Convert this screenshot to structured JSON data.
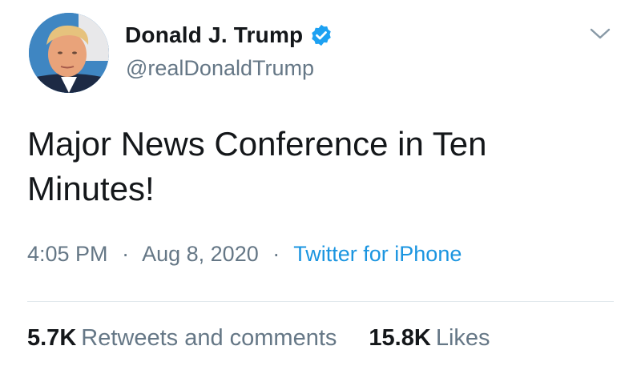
{
  "user": {
    "display_name": "Donald J. Trump",
    "handle": "@realDonaldTrump",
    "verified": true
  },
  "tweet": {
    "text": "Major News Conference in Ten Minutes!",
    "time": "4:05 PM",
    "separator": "·",
    "date": "Aug 8, 2020",
    "source": "Twitter for iPhone"
  },
  "stats": {
    "retweets_count": "5.7K",
    "retweets_label": "Retweets and comments",
    "likes_count": "15.8K",
    "likes_label": "Likes"
  },
  "icons": {
    "verified": "verified-badge-icon",
    "more": "chevron-down-icon"
  },
  "colors": {
    "verified_blue": "#1da1f2",
    "link_blue": "#1b95e0",
    "secondary_text": "#657786",
    "primary_text": "#14171a"
  }
}
